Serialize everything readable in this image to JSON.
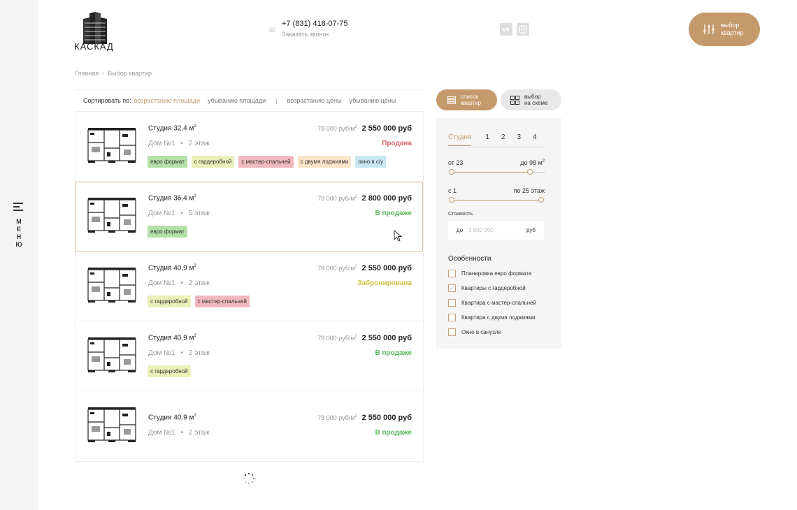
{
  "brand": {
    "name": "КАСКАД"
  },
  "sidebar": {
    "menu_label": "МЕНЮ"
  },
  "header": {
    "phone": "+7 (831) 418-07-75",
    "callback": "Заказать звонок",
    "social": [
      {
        "icon": "vk-icon",
        "label": "vk"
      },
      {
        "icon": "instagram-icon",
        "label": "ig"
      }
    ],
    "choose_button": {
      "line1": "выбор",
      "line2": "квартир"
    }
  },
  "breadcrumb": {
    "home": "Главная",
    "separator": "-",
    "current": "Выбор квартир"
  },
  "sort": {
    "label": "Сортировать по:",
    "options": [
      "возрастанию площади",
      "убыванию площади",
      "возрастанию цены",
      "убыванию цены"
    ],
    "active_index": 0,
    "separator": "|"
  },
  "view_buttons": {
    "list": {
      "line1": "список",
      "line2": "квартир"
    },
    "scheme": {
      "line1": "выбор",
      "line2": "на схеме"
    }
  },
  "listings": [
    {
      "title": "Студия 32,4 м",
      "sup": "2",
      "house": "Дом №1",
      "floor": "2 этаж",
      "ppm": "78 000 руб/м",
      "ppm_sup": "2",
      "price": "2 550 000 руб",
      "status": "Продана",
      "status_color": "#d9646d",
      "tags": [
        {
          "text": "евро формат",
          "color": "#b4e0a8"
        },
        {
          "text": "с гардеробной",
          "color": "#eaf0b8"
        },
        {
          "text": "с мастер-спальней",
          "color": "#f2b8c0"
        },
        {
          "text": "с двумя лоджиями",
          "color": "#fbe3c8"
        },
        {
          "text": "окно в с/у",
          "color": "#c8e8f3"
        }
      ]
    },
    {
      "title": "Студия 36,4 м",
      "sup": "2",
      "house": "Дом №1",
      "floor": "5 этаж",
      "ppm": "78 000 руб/м",
      "ppm_sup": "2",
      "price": "2 800 000 руб",
      "status": "В продаже",
      "status_color": "#5cb85c",
      "tags": [
        {
          "text": "евро формат",
          "color": "#b4e0a8"
        }
      ]
    },
    {
      "title": "Студия 40,9 м",
      "sup": "2",
      "house": "Дом №1",
      "floor": "2 этаж",
      "ppm": "78 000 руб/м",
      "ppm_sup": "2",
      "price": "2 550 000 руб",
      "status": "Забронирована",
      "status_color": "#c9c244",
      "tags": [
        {
          "text": "с гардеробной",
          "color": "#eaf0b8"
        },
        {
          "text": "с мастер-спальней",
          "color": "#f2b8c0"
        }
      ]
    },
    {
      "title": "Студия 40,9 м",
      "sup": "2",
      "house": "Дом №1",
      "floor": "2 этаж",
      "ppm": "78 000 руб/м",
      "ppm_sup": "2",
      "price": "2 550 000 руб",
      "status": "В продаже",
      "status_color": "#5cb85c",
      "tags": [
        {
          "text": "с гардеробной",
          "color": "#eaf0b8"
        }
      ]
    },
    {
      "title": "Студия 40,9 м",
      "sup": "2",
      "house": "Дом №1",
      "floor": "2 этаж",
      "ppm": "78 000 руб/м",
      "ppm_sup": "2",
      "price": "2 550 000 руб",
      "status": "В продаже",
      "status_color": "#5cb85c",
      "tags": []
    }
  ],
  "filter": {
    "rooms": [
      "Студия",
      "1",
      "2",
      "3",
      "4"
    ],
    "active_room": 0,
    "area": {
      "from": "от 23",
      "to": "до 98 м",
      "to_sup": "2"
    },
    "floor": {
      "from": "с 1",
      "to": "по 25 этаж"
    },
    "cost": {
      "label": "Стоимость",
      "prefix": "до",
      "placeholder": "3 000 000",
      "unit": "руб"
    },
    "features_title": "Особенности",
    "features": [
      {
        "label": "Планировка евро формата",
        "checked": false
      },
      {
        "label": "Квартиры с гардеробной",
        "checked": true
      },
      {
        "label": "Квартира с мастер-спальней",
        "checked": false
      },
      {
        "label": "Квартира с двумя лоджиями",
        "checked": false
      },
      {
        "label": "Окно в санузле",
        "checked": false
      }
    ]
  }
}
